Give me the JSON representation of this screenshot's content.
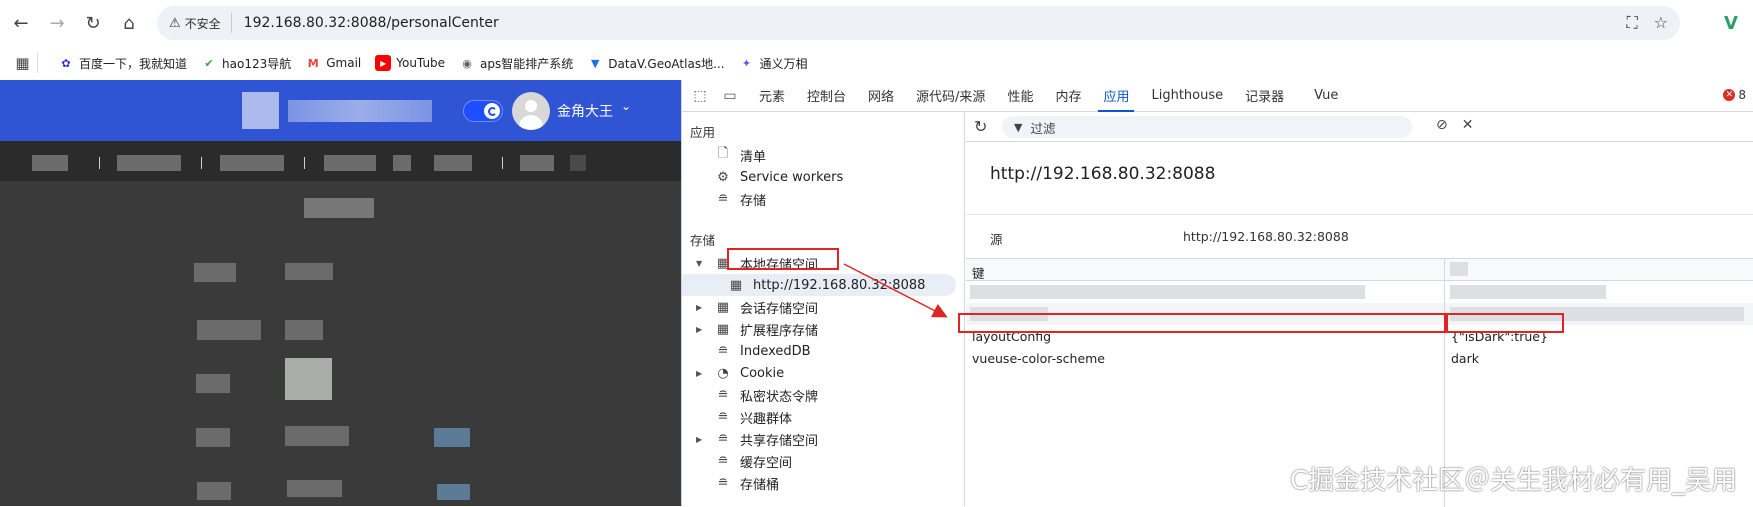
{
  "browser": {
    "insecure_label": "不安全",
    "url": "192.168.80.32:8088/personalCenter",
    "extension_label": "V",
    "bookmarks": [
      {
        "label": "百度一下，我就知道",
        "icon": "baidu-icon",
        "color": "#2932e1"
      },
      {
        "label": "hao123导航",
        "icon": "hao123-icon",
        "color": "#3aa63a"
      },
      {
        "label": "Gmail",
        "icon": "gmail-icon",
        "color": "#ea4335"
      },
      {
        "label": "YouTube",
        "icon": "youtube-icon",
        "color": "#ff0000"
      },
      {
        "label": "aps智能排产系统",
        "icon": "globe-icon",
        "color": "#5f6368"
      },
      {
        "label": "DataV.GeoAtlas地...",
        "icon": "datav-icon",
        "color": "#1a73e8"
      },
      {
        "label": "通义万相",
        "icon": "tongyi-icon",
        "color": "#6b4eff"
      }
    ]
  },
  "app": {
    "user_name": "金角大王",
    "header_color": "#2f55d4",
    "bg_color": "#3a3a3a"
  },
  "devtools": {
    "tabs": [
      "元素",
      "控制台",
      "网络",
      "源代码/来源",
      "性能",
      "内存",
      "应用",
      "Lighthouse",
      "记录器",
      "Vue"
    ],
    "active_tab": "应用",
    "error_count": "8",
    "sidebar": {
      "section_app": "应用",
      "app_items": [
        "清单",
        "Service workers",
        "存储"
      ],
      "section_storage": "存储",
      "local_storage": "本地存储空间",
      "local_storage_origin": "http://192.168.80.32:8088",
      "storage_items": [
        "会话存储空间",
        "扩展程序存储",
        "IndexedDB",
        "Cookie",
        "私密状态令牌",
        "兴趣群体",
        "共享存储空间",
        "缓存空间",
        "存储桶"
      ]
    },
    "filter_placeholder": "过滤",
    "origin_title": "http://192.168.80.32:8088",
    "origin_label": "源",
    "origin_value": "http://192.168.80.32:8088",
    "table": {
      "key_header": "键",
      "rows": [
        {
          "key": "layoutConfig",
          "value": "{\"isDark\":true}"
        },
        {
          "key": "vueuse-color-scheme",
          "value": "dark"
        }
      ]
    }
  },
  "watermark": "C掘金技术社区＠关生我材必有用_吴用",
  "highlight_color": "#e02424"
}
